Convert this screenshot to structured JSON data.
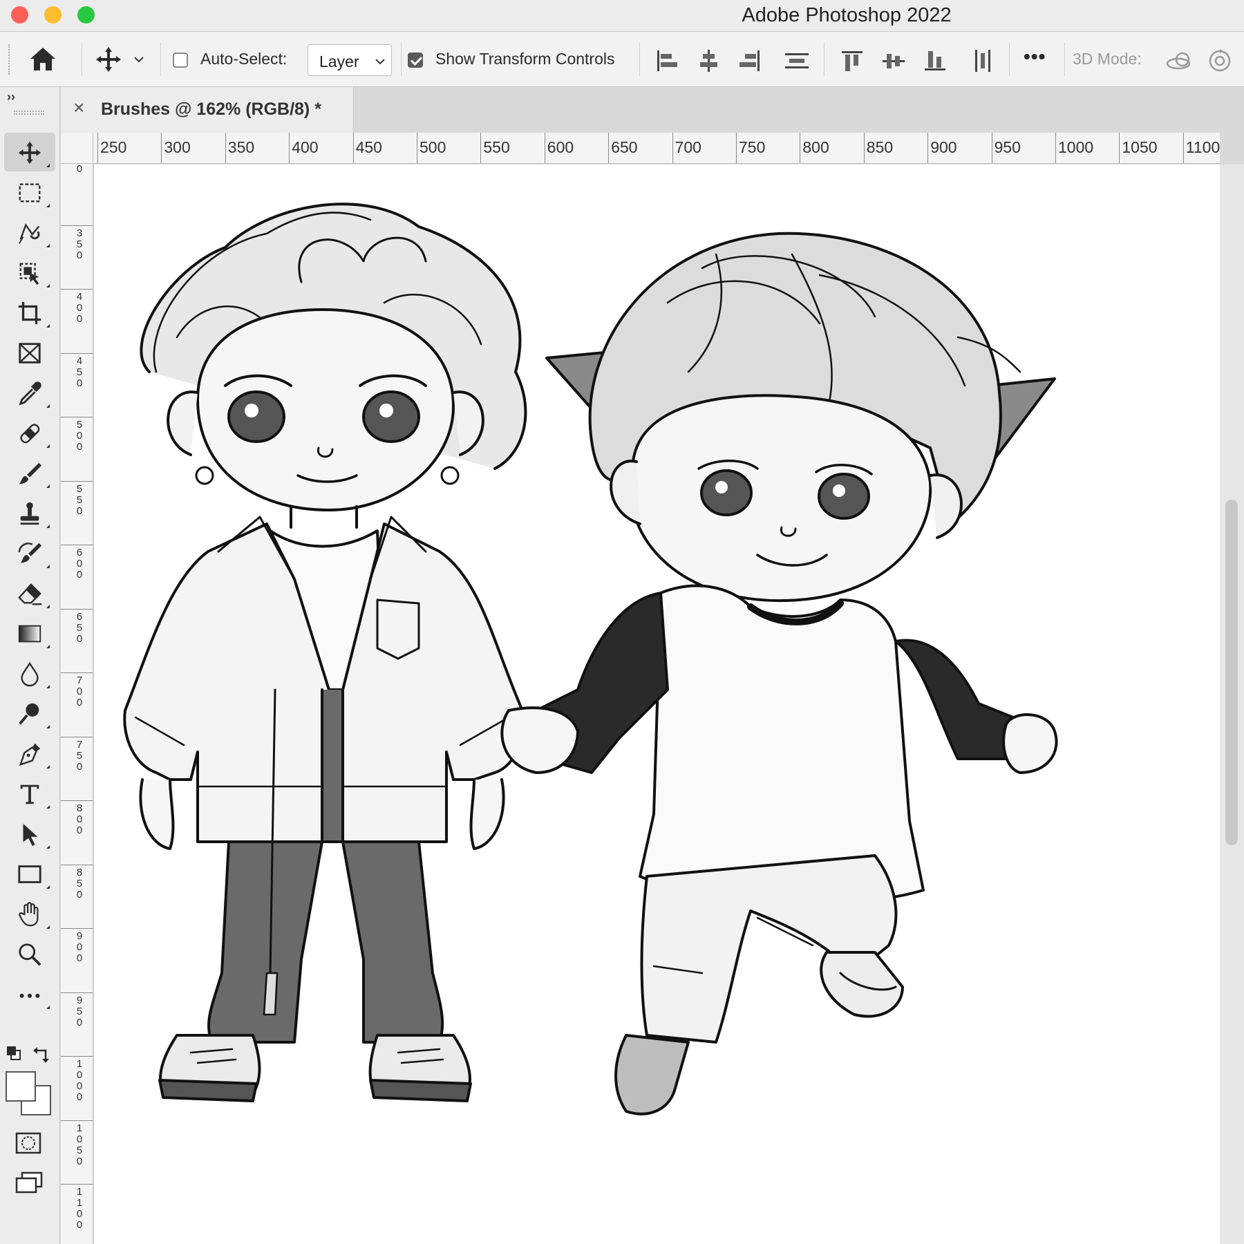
{
  "window": {
    "title": "Adobe Photoshop 2022",
    "traffic_lights": [
      "close",
      "minimize",
      "zoom"
    ],
    "colors": {
      "close": "#fe5f57",
      "minimize": "#febc2e",
      "zoom": "#28c840"
    }
  },
  "options_bar": {
    "home_icon": "home-icon",
    "move_tool_icon": "move-icon",
    "auto_select_label": "Auto-Select:",
    "auto_select_checked": false,
    "layer_dropdown_value": "Layer",
    "show_transform_label": "Show Transform Controls",
    "show_transform_checked": true,
    "more_label": "•••",
    "mode_3d_label": "3D Mode:"
  },
  "document_tab": {
    "close_glyph": "×",
    "title": "Brushes @ 162% (RGB/8) *"
  },
  "ruler_h": [
    "250",
    "300",
    "350",
    "400",
    "450",
    "500",
    "550",
    "600",
    "650",
    "700",
    "750",
    "800",
    "850",
    "900",
    "950",
    "1000",
    "1050",
    "1100"
  ],
  "ruler_v": [
    "0",
    "350",
    "400",
    "450",
    "500",
    "550",
    "600",
    "650",
    "700",
    "750",
    "800",
    "850",
    "900",
    "950",
    "1000",
    "1050",
    "1100",
    "1"
  ],
  "tools": [
    {
      "name": "move",
      "icon": "move-icon",
      "active": true
    },
    {
      "name": "marquee",
      "icon": "rectangular-marquee-icon"
    },
    {
      "name": "lasso",
      "icon": "magnetic-lasso-icon"
    },
    {
      "name": "object-select",
      "icon": "object-selection-icon"
    },
    {
      "name": "crop",
      "icon": "crop-icon"
    },
    {
      "name": "frame",
      "icon": "frame-icon"
    },
    {
      "name": "eyedropper",
      "icon": "eyedropper-icon"
    },
    {
      "name": "healing",
      "icon": "bandage-icon"
    },
    {
      "name": "brush",
      "icon": "brush-icon"
    },
    {
      "name": "stamp",
      "icon": "clone-stamp-icon"
    },
    {
      "name": "history-brush",
      "icon": "history-brush-icon"
    },
    {
      "name": "eraser",
      "icon": "eraser-icon"
    },
    {
      "name": "gradient",
      "icon": "gradient-icon"
    },
    {
      "name": "blur",
      "icon": "drop-icon"
    },
    {
      "name": "dodge",
      "icon": "dodge-icon"
    },
    {
      "name": "pen",
      "icon": "pen-icon"
    },
    {
      "name": "type",
      "icon": "type-icon"
    },
    {
      "name": "path-select",
      "icon": "arrow-icon"
    },
    {
      "name": "rectangle",
      "icon": "rectangle-icon"
    },
    {
      "name": "hand",
      "icon": "hand-icon"
    },
    {
      "name": "zoom",
      "icon": "zoom-icon"
    },
    {
      "name": "more",
      "icon": "ellipsis-icon"
    }
  ],
  "canvas": {
    "description_free": true,
    "fg_color": "#ffffff",
    "bg_color": "#ffffff"
  }
}
